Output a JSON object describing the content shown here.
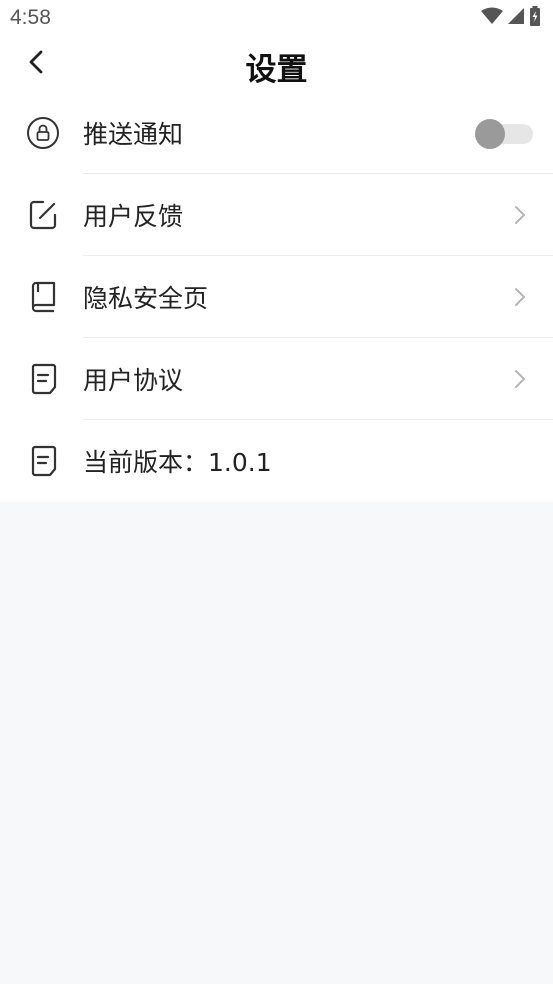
{
  "status_bar": {
    "time": "4:58",
    "icons": [
      "wifi-icon",
      "cellular-signal-icon",
      "battery-charging-icon"
    ]
  },
  "header": {
    "title": "设置",
    "back_icon": "chevron-left-icon"
  },
  "settings": {
    "items": [
      {
        "label": "推送通知",
        "icon": "lock-circle-icon",
        "control": "toggle",
        "toggle_on": false
      },
      {
        "label": "用户反馈",
        "icon": "edit-icon",
        "control": "chevron"
      },
      {
        "label": "隐私安全页",
        "icon": "book-icon",
        "control": "chevron"
      },
      {
        "label": "用户协议",
        "icon": "document-icon",
        "control": "chevron"
      },
      {
        "label": "当前版本：1.0.1",
        "icon": "document-icon",
        "control": "none"
      }
    ]
  },
  "colors": {
    "background": "#f7f8fa",
    "card": "#ffffff",
    "toggle_off_knob": "#9a9a9a",
    "toggle_off_track": "#e6e6e6"
  }
}
